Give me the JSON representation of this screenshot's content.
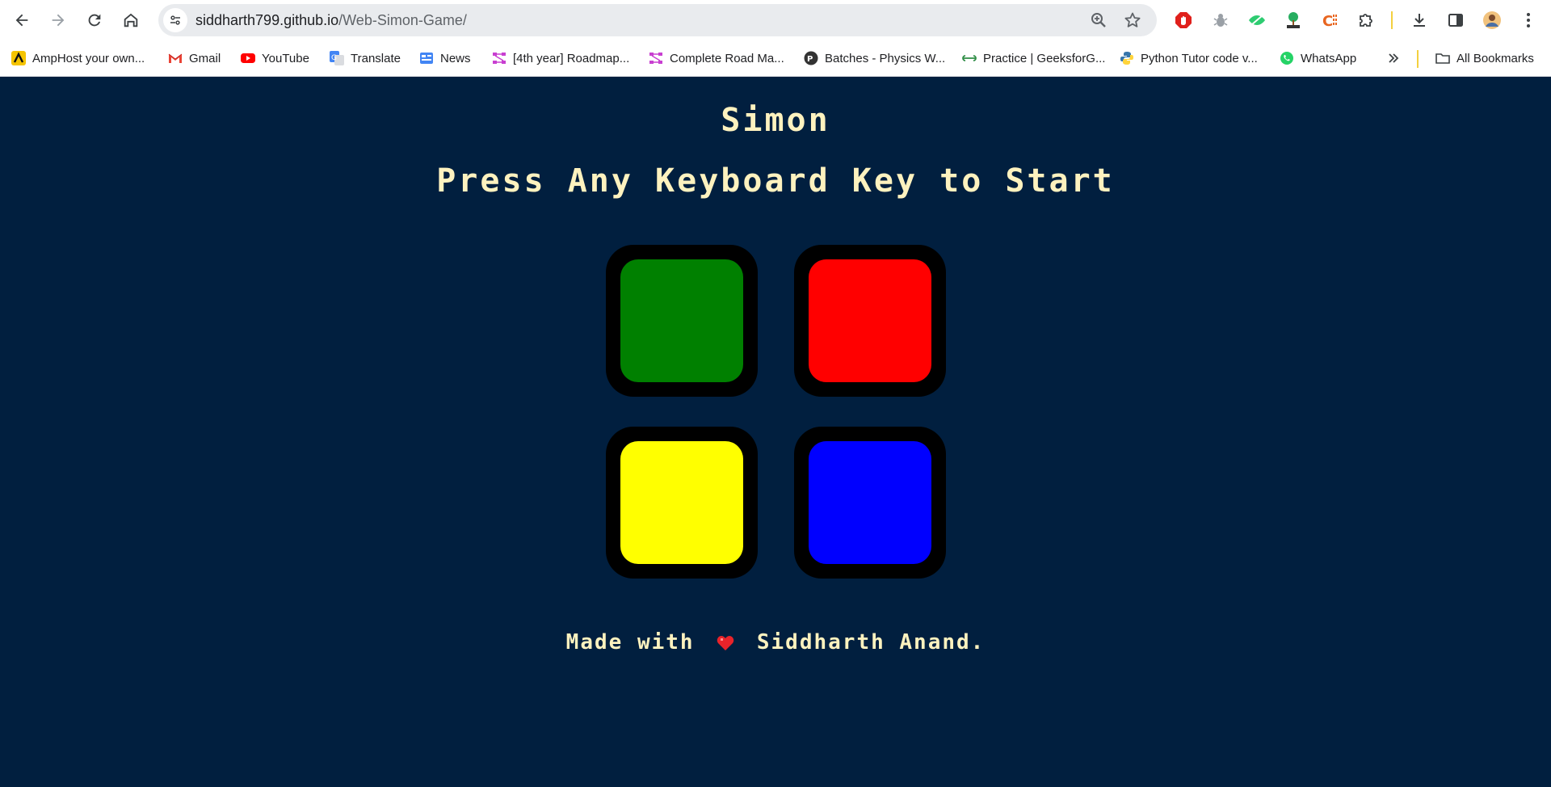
{
  "browser": {
    "url_domain": "siddharth799.github.io",
    "url_path": "/Web-Simon-Game/",
    "icons": [
      "back-icon",
      "forward-icon",
      "reload-icon",
      "home-icon",
      "site-info-icon",
      "zoom-icon",
      "star-icon",
      "download-icon",
      "side-panel-icon",
      "menu-icon"
    ],
    "bookmarks": [
      {
        "label": "AmpHost your own...",
        "icon": "amphost-icon"
      },
      {
        "label": "Gmail",
        "icon": "gmail-icon"
      },
      {
        "label": "YouTube",
        "icon": "youtube-icon"
      },
      {
        "label": "Translate",
        "icon": "translate-icon"
      },
      {
        "label": "News",
        "icon": "news-icon"
      },
      {
        "label": "[4th year] Roadmap...",
        "icon": "roadmap-icon"
      },
      {
        "label": "Complete Road Ma...",
        "icon": "roadmap-icon"
      },
      {
        "label": "Batches - Physics W...",
        "icon": "physics-wallah-icon"
      },
      {
        "label": "Practice | GeeksforG...",
        "icon": "geeksforgeeks-icon"
      },
      {
        "label": "Python Tutor code v...",
        "icon": "python-icon"
      },
      {
        "label": "WhatsApp",
        "icon": "whatsapp-icon"
      }
    ],
    "all_bookmarks_label": "All Bookmarks"
  },
  "game": {
    "title": "Simon",
    "subtitle": "Press Any Keyboard Key to Start",
    "pads": [
      {
        "name": "green",
        "color": "#008000"
      },
      {
        "name": "red",
        "color": "#FF0000"
      },
      {
        "name": "yellow",
        "color": "#FFFF00"
      },
      {
        "name": "blue",
        "color": "#0000FF"
      }
    ],
    "footer_prefix": "Made with",
    "footer_suffix": "Siddharth Anand."
  },
  "colors": {
    "background": "#011F3F",
    "text": "#FEF2BF"
  }
}
